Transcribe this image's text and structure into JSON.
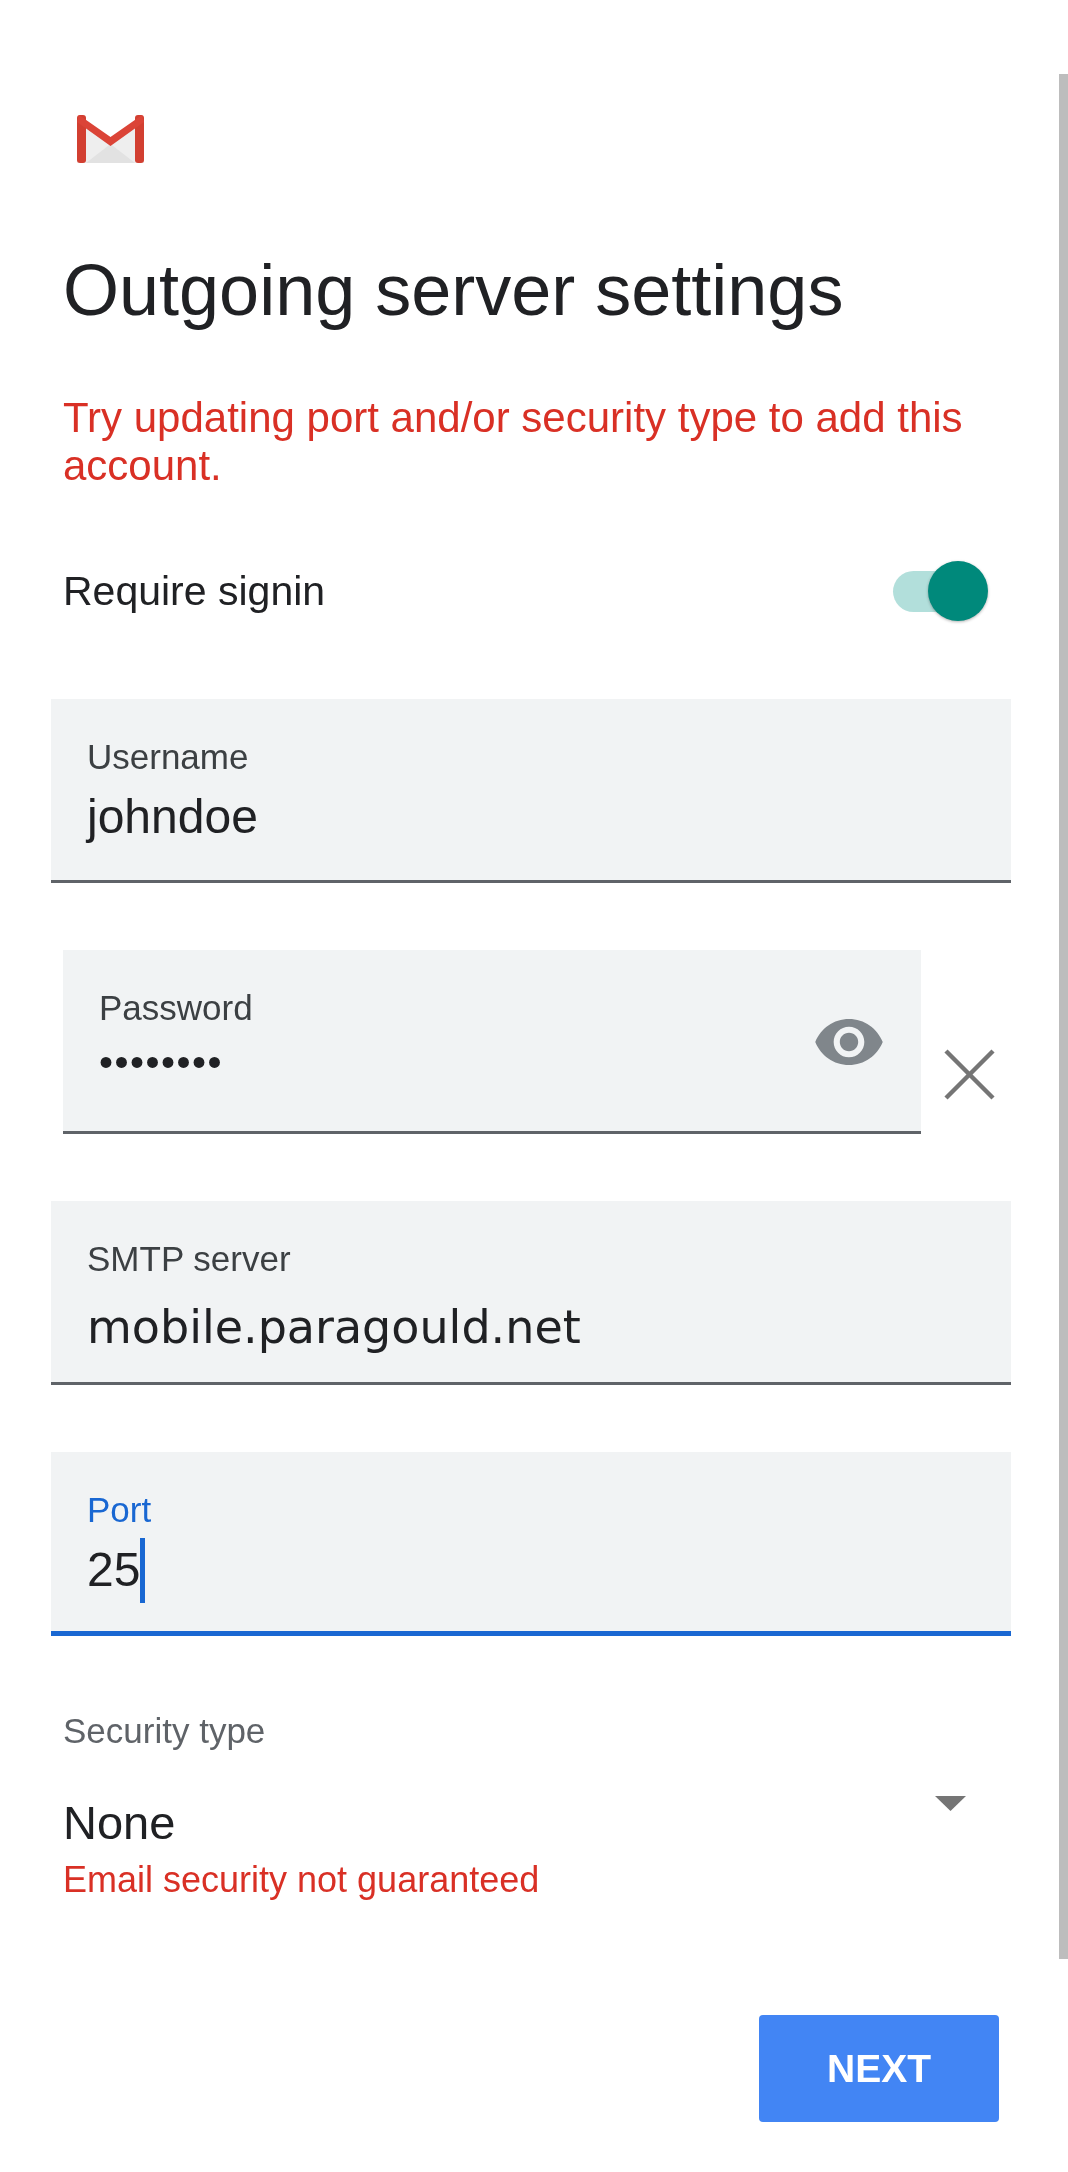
{
  "title": "Outgoing server settings",
  "error_message": "Try updating port and/or security type to add this account.",
  "require_signin": {
    "label": "Require signin",
    "on": true
  },
  "fields": [
    {
      "kind": "text",
      "label": "Username",
      "value": "johndoe",
      "focused": false
    },
    {
      "kind": "password",
      "label": "Password",
      "value": "••••••••",
      "focused": false
    },
    {
      "kind": "hostname",
      "label": "SMTP server",
      "value": "mobile.paragould.net",
      "focused": false
    },
    {
      "kind": "text",
      "label": "Port",
      "value": "25",
      "focused": true
    }
  ],
  "security_type": {
    "label": "Security type",
    "value": "None",
    "warning": "Email security not guaranteed"
  },
  "next_button": {
    "label": "NEXT"
  }
}
